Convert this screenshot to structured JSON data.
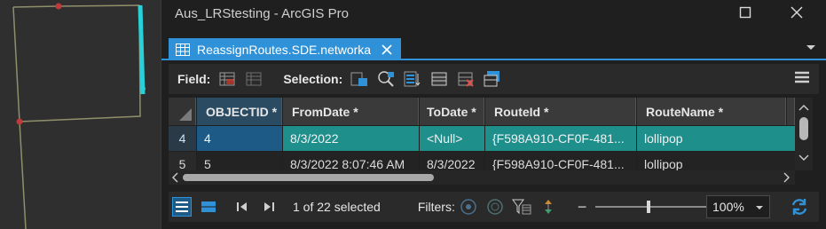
{
  "window": {
    "title": "Aus_LRStesting - ArcGIS Pro"
  },
  "tab": {
    "label": "ReassignRoutes.SDE.networka"
  },
  "toolbar": {
    "field_label": "Field:",
    "selection_label": "Selection:"
  },
  "table": {
    "columns": [
      "OBJECTID *",
      "FromDate *",
      "ToDate *",
      "RouteId *",
      "RouteName *"
    ],
    "rows": [
      {
        "row_num": "4",
        "objectid": "4",
        "fromdate": "8/3/2022",
        "todate": "<Null>",
        "routeid": "{F598A910-CF0F-481...",
        "routename": "lollipop"
      },
      {
        "row_num": "5",
        "objectid": "5",
        "fromdate": "8/3/2022 8:07:46 AM",
        "todate": "8/3/2022",
        "routeid": "{F598A910-CF0F-481...",
        "routename": "lollipop"
      }
    ]
  },
  "status": {
    "selection_count": "1 of 22 selected",
    "filters_label": "Filters:",
    "zoom": "100%"
  },
  "colors": {
    "accent": "#2f92d8",
    "selected_row": "#1f8f8c",
    "map_line": "#8f8f6a",
    "route_highlight": "#2ad0d8",
    "vertex": "#c0393b"
  },
  "icons": [
    "close-icon",
    "maximize-icon",
    "table-icon",
    "menu-icon",
    "refresh-icon"
  ]
}
